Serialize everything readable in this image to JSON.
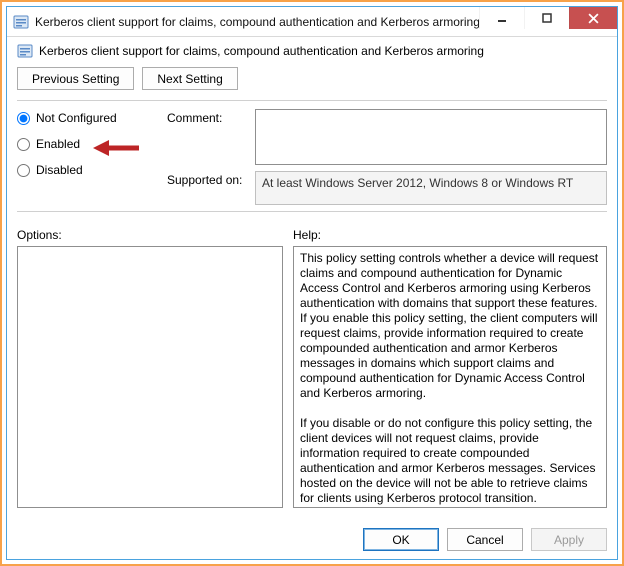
{
  "window": {
    "title": "Kerberos client support for claims, compound authentication and Kerberos armoring"
  },
  "subtitle": "Kerberos client support for claims, compound authentication and Kerberos armoring",
  "nav": {
    "previous": "Previous Setting",
    "next": "Next Setting"
  },
  "radios": {
    "not_configured": "Not Configured",
    "enabled": "Enabled",
    "disabled": "Disabled",
    "selected": "not_configured"
  },
  "labels": {
    "comment": "Comment:",
    "supported_on": "Supported on:",
    "options": "Options:",
    "help": "Help:"
  },
  "comment_value": "",
  "supported_on_value": "At least Windows Server 2012, Windows 8 or Windows RT",
  "options_value": "",
  "help_text": "This policy setting controls whether a device will request claims and compound authentication for Dynamic Access Control and Kerberos armoring using Kerberos authentication with domains that support these features.\nIf you enable this policy setting, the client computers will request claims, provide information required to create compounded authentication and armor Kerberos messages in domains which support claims and compound authentication for Dynamic Access Control and Kerberos armoring.\n\nIf you disable or do not configure this policy setting, the client devices will not request claims, provide information required to create compounded authentication and armor Kerberos messages. Services hosted on the device will not be able to retrieve claims for clients using Kerberos protocol transition.",
  "footer": {
    "ok": "OK",
    "cancel": "Cancel",
    "apply": "Apply"
  },
  "colors": {
    "highlight_border": "#f7a24a",
    "window_border": "#4aa3df",
    "close_btn": "#c75050",
    "arrow": "#bd2526"
  }
}
